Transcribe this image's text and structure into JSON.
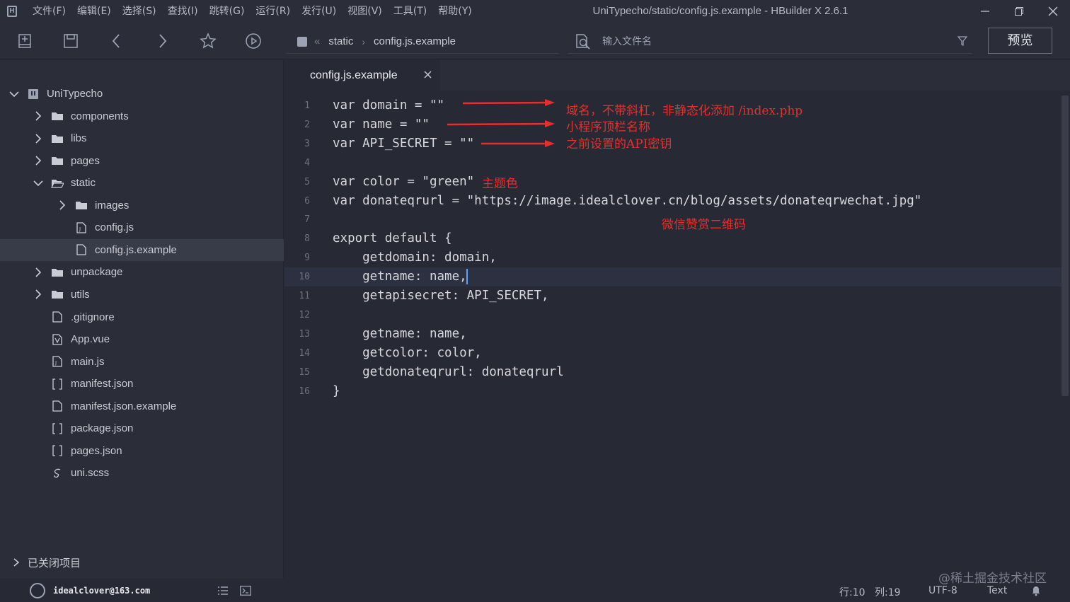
{
  "app": {
    "window_title": "UniTypecho/static/config.js.example - HBuilder X 2.6.1",
    "logo_letter": "H"
  },
  "menu": [
    "文件(F)",
    "编辑(E)",
    "选择(S)",
    "查找(I)",
    "跳转(G)",
    "运行(R)",
    "发行(U)",
    "视图(V)",
    "工具(T)",
    "帮助(Y)"
  ],
  "breadcrumb": {
    "folder": "static",
    "file": "config.js.example"
  },
  "search": {
    "placeholder": "输入文件名"
  },
  "preview_label": "预览",
  "tree": [
    {
      "label": "UniTypecho",
      "depth": 0,
      "chevron": "down",
      "icon": "project-icon"
    },
    {
      "label": "components",
      "depth": 1,
      "chevron": "right",
      "icon": "folder-icon"
    },
    {
      "label": "libs",
      "depth": 1,
      "chevron": "right",
      "icon": "folder-icon"
    },
    {
      "label": "pages",
      "depth": 1,
      "chevron": "right",
      "icon": "folder-icon"
    },
    {
      "label": "static",
      "depth": 1,
      "chevron": "down",
      "icon": "folder-open-icon"
    },
    {
      "label": "images",
      "depth": 2,
      "chevron": "right",
      "icon": "folder-icon"
    },
    {
      "label": "config.js",
      "depth": 2,
      "chevron": "none",
      "icon": "js-file-icon"
    },
    {
      "label": "config.js.example",
      "depth": 2,
      "chevron": "none",
      "icon": "file-icon",
      "selected": true
    },
    {
      "label": "unpackage",
      "depth": 1,
      "chevron": "right",
      "icon": "folder-icon"
    },
    {
      "label": "utils",
      "depth": 1,
      "chevron": "right",
      "icon": "folder-icon"
    },
    {
      "label": ".gitignore",
      "depth": 1,
      "chevron": "none",
      "icon": "file-icon"
    },
    {
      "label": "App.vue",
      "depth": 1,
      "chevron": "none",
      "icon": "vue-file-icon"
    },
    {
      "label": "main.js",
      "depth": 1,
      "chevron": "none",
      "icon": "js-file-icon"
    },
    {
      "label": "manifest.json",
      "depth": 1,
      "chevron": "none",
      "icon": "json-file-icon"
    },
    {
      "label": "manifest.json.example",
      "depth": 1,
      "chevron": "none",
      "icon": "file-icon"
    },
    {
      "label": "package.json",
      "depth": 1,
      "chevron": "none",
      "icon": "json-file-icon"
    },
    {
      "label": "pages.json",
      "depth": 1,
      "chevron": "none",
      "icon": "json-file-icon"
    },
    {
      "label": "uni.scss",
      "depth": 1,
      "chevron": "none",
      "icon": "scss-file-icon"
    }
  ],
  "closed_projects_label": "已关闭项目",
  "tab": {
    "label": "config.js.example"
  },
  "code_lines": [
    "var domain = \"\"",
    "var name = \"\"",
    "var API_SECRET = \"\"",
    "",
    "var color = \"green\"",
    "var donateqrurl = \"https://image.idealclover.cn/blog/assets/donateqrwechat.jpg\"",
    "",
    "export default {",
    "    getdomain: domain,",
    "    getname: name,",
    "    getapisecret: API_SECRET,",
    "",
    "    getname: name,",
    "    getcolor: color,",
    "    getdonateqrurl: donateqrurl",
    "}"
  ],
  "current_line": 10,
  "annotations": {
    "domain": "域名，不带斜杠，非静态化添加 /index.php",
    "name": "小程序顶栏名称",
    "secret": "之前设置的API密钥",
    "color": "主题色",
    "donate": "微信赞赏二维码"
  },
  "colors": {
    "annotation": "#e3302e",
    "caret": "#5aa2ff",
    "background": "#272a35"
  },
  "status": {
    "user": "idealclover@163.com",
    "line": "行:10",
    "col": "列:19",
    "encoding": "UTF-8",
    "mode": "Text"
  },
  "watermark": "@稀土掘金技术社区"
}
